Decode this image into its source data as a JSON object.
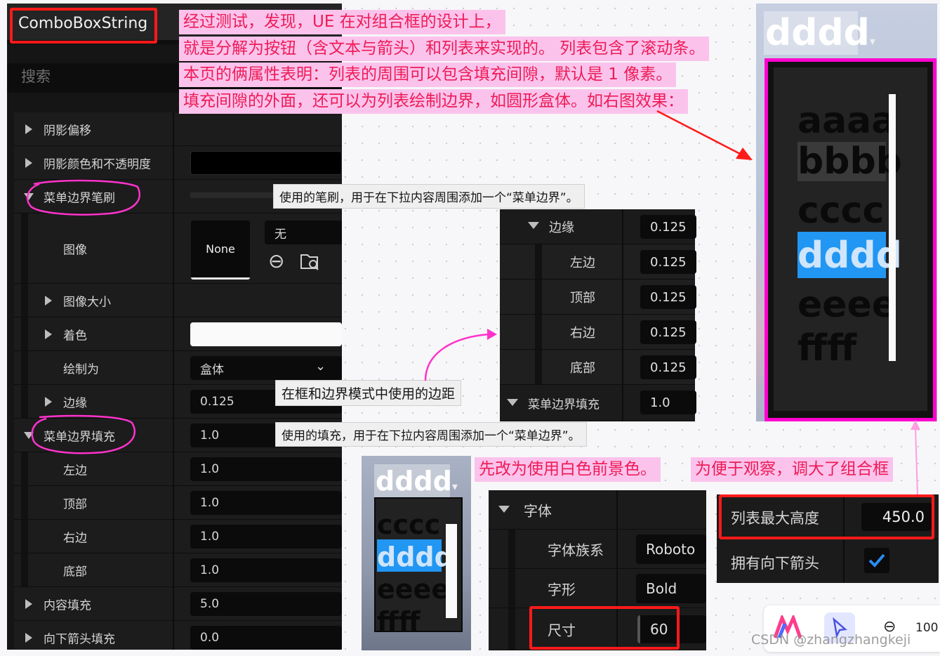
{
  "widget_title": "ComboBoxString",
  "search_placeholder": "搜索",
  "properties": {
    "shadow_offset": "阴影偏移",
    "shadow_color": "阴影颜色和不透明度",
    "menu_border_brush": "菜单边界笔刷",
    "image": "图像",
    "image_thumb": "None",
    "image_asset": "无",
    "image_size": "图像大小",
    "tint": "着色",
    "draw_as": "绘制为",
    "draw_as_value": "盒体",
    "margin": "边缘",
    "margin_value": "0.125",
    "menu_border_padding": "菜单边界填充",
    "menu_border_padding_value": "1.0",
    "left": "左边",
    "left_value": "1.0",
    "top": "顶部",
    "top_value": "1.0",
    "right": "右边",
    "right_value": "1.0",
    "bottom": "底部",
    "bottom_value": "1.0",
    "content_padding": "内容填充",
    "content_padding_value": "5.0",
    "down_arrow_padding": "向下箭头填充",
    "down_arrow_padding_value": "0.0"
  },
  "notes": {
    "line1": "经过测试，发现，UE 在对组合框的设计上，",
    "line2": "就是分解为按钮（含文本与箭头）和列表来实现的。 列表包含了滚动条。",
    "line3": "本页的俩属性表明：列表的周围可以包含填充间隙，默认是 1 像素。",
    "line4": "填充间隙的外面，还可以为列表绘制边界，如圆形盒体。如右图效果：",
    "white_fg": "先改为使用白色前景色。",
    "enlarge": "为便于观察，调大了组合框"
  },
  "tooltips": {
    "brush": "使用的笔刷，用于在下拉内容周围添加一个“菜单边界”。",
    "margin": "在框和边界模式中使用的边距",
    "padding": "使用的填充，用于在下拉内容周围添加一个“菜单边界”。"
  },
  "edge_panel": {
    "title": "边缘",
    "title_value": "0.125",
    "left": "左边",
    "left_value": "0.125",
    "top": "顶部",
    "top_value": "0.125",
    "right": "右边",
    "right_value": "0.125",
    "bottom": "底部",
    "bottom_value": "0.125",
    "padding": "菜单边界填充",
    "padding_value": "1.0"
  },
  "font_panel": {
    "title": "字体",
    "family": "字体族系",
    "family_value": "Roboto",
    "style": "字形",
    "style_value": "Bold",
    "size": "尺寸",
    "size_value": "60"
  },
  "list_panel": {
    "max_height": "列表最大高度",
    "max_height_value": "450.0",
    "has_down_arrow": "拥有向下箭头"
  },
  "preview_big": {
    "selected": "dddd",
    "items": [
      "aaaa",
      "bbbb",
      "cccc",
      "dddd",
      "eeee",
      "ffff"
    ]
  },
  "preview_small": {
    "selected": "dddd",
    "items": [
      "cccc",
      "dddd",
      "eeee",
      "ffff"
    ]
  },
  "toolbar": {
    "zoom": "100"
  },
  "watermark": "CSDN @zhangzhangkeji",
  "colors": {
    "note_bg": "#fbc3ec",
    "note_text": "#ee1b56",
    "highlight": "#ff1a1a",
    "magenta_border": "#ff00d0",
    "selected_item": "#2196f3"
  }
}
